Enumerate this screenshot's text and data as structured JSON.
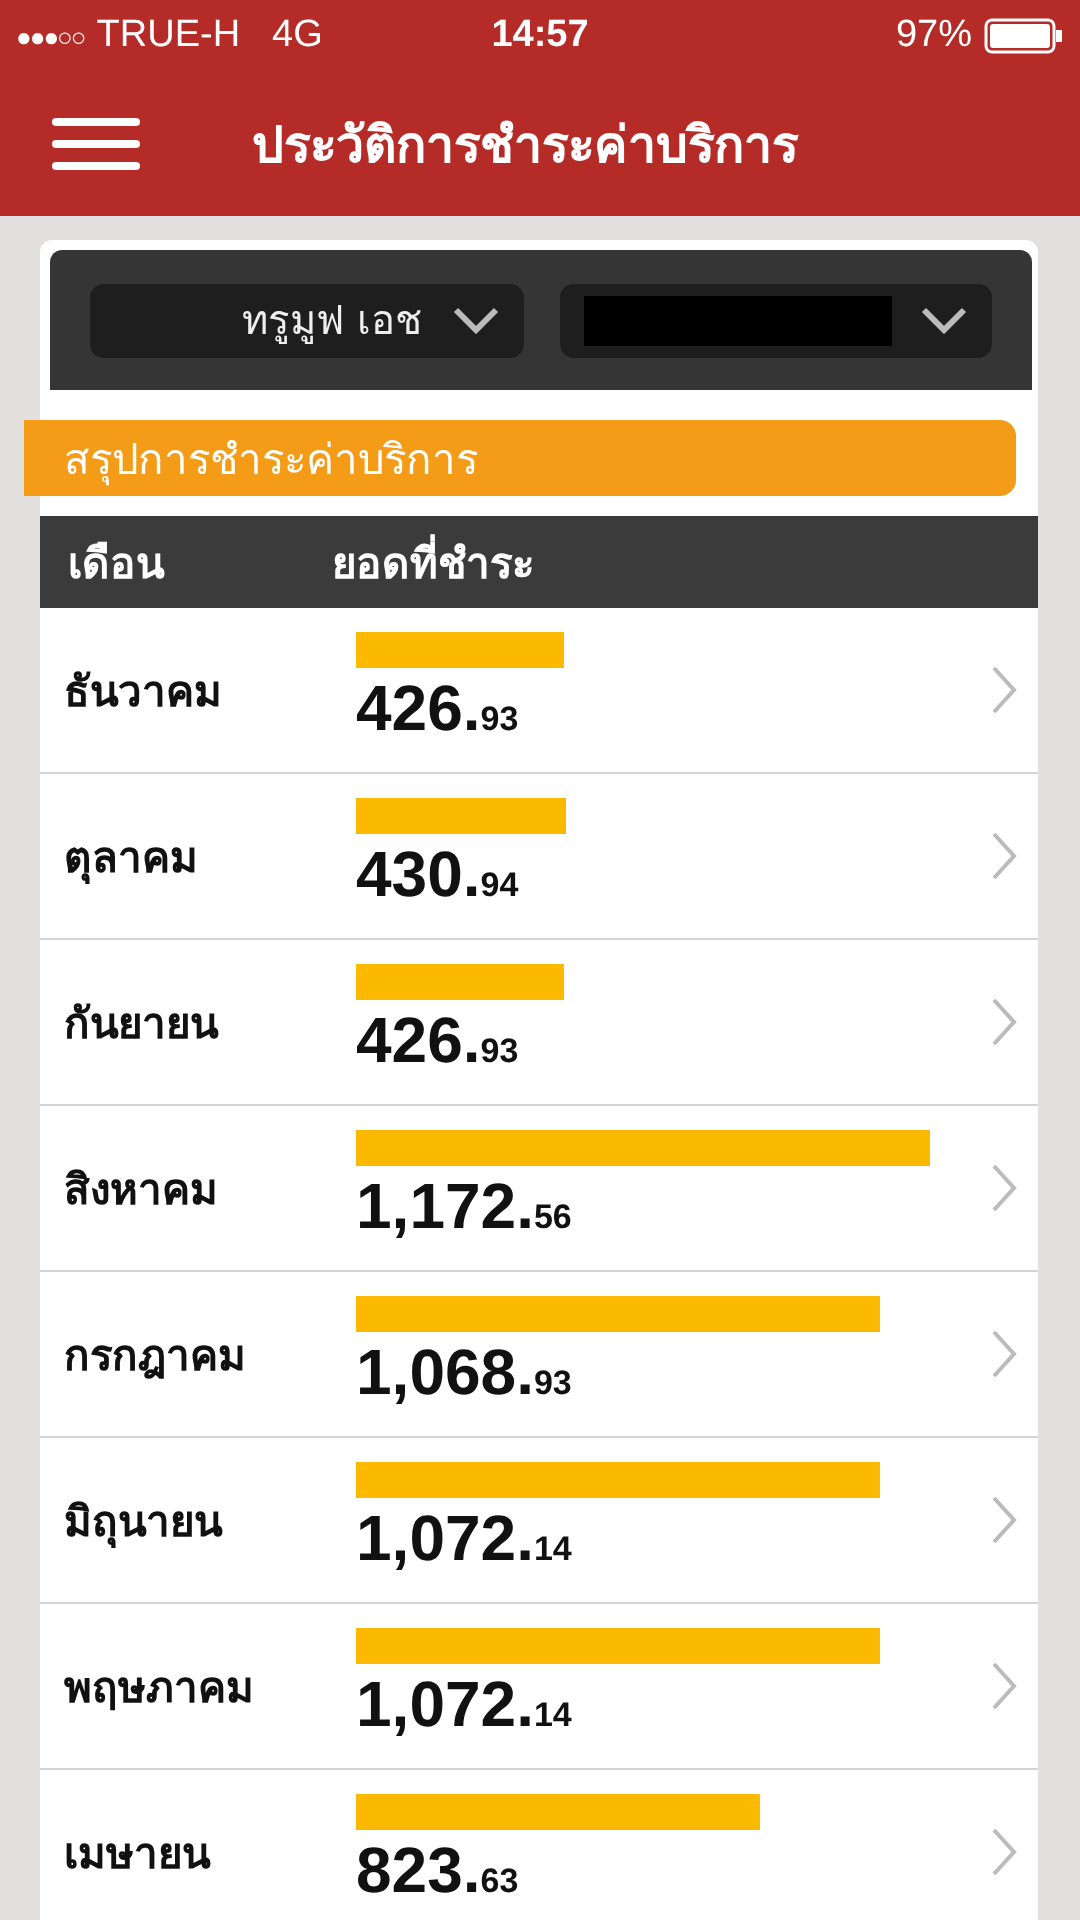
{
  "status_bar": {
    "carrier": "TRUE-H",
    "network": "4G",
    "time": "14:57",
    "battery": "97%",
    "signal": "●●●○○"
  },
  "nav": {
    "title": "ประวัติการชำระค่าบริการ"
  },
  "selectors": [
    {
      "kind": "text",
      "value": "ทรูมูฟ เอช"
    },
    {
      "kind": "redacted"
    }
  ],
  "section": {
    "title": "สรุปการชำระค่าบริการ"
  },
  "table": {
    "columns": [
      "เดือน",
      "ยอดที่ชำระ"
    ],
    "rows": [
      {
        "month": "ธันวาคม",
        "amount": "426.",
        "decimals": "93"
      },
      {
        "month": "ตุลาคม",
        "amount": "430.",
        "decimals": "94"
      },
      {
        "month": "กันยายน",
        "amount": "426.",
        "decimals": "93"
      },
      {
        "month": "สิงหาคม",
        "amount": "1,172.",
        "decimals": "56"
      },
      {
        "month": "กรกฎาคม",
        "amount": "1,068.",
        "decimals": "93"
      },
      {
        "month": "มิถุนายน",
        "amount": "1,072.",
        "decimals": "14"
      },
      {
        "month": "พฤษภาคม",
        "amount": "1,072.",
        "decimals": "14"
      },
      {
        "month": "เมษายน",
        "amount": "823.",
        "decimals": "63"
      }
    ]
  }
}
